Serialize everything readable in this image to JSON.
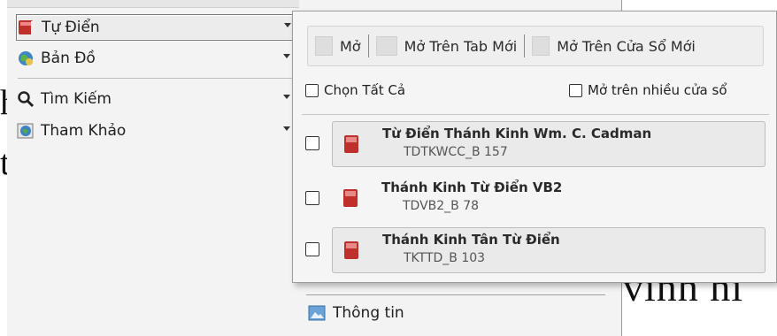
{
  "background": {
    "text_h": "h",
    "text_t": "t",
    "text_vinh": "vinh hi"
  },
  "left_menu": {
    "items": [
      {
        "label": "Tự Điển",
        "icon": "dictionary-book-icon"
      },
      {
        "label": "Bản Đồ",
        "icon": "globe-map-icon"
      },
      {
        "label": "Tìm Kiếm",
        "icon": "search-icon"
      },
      {
        "label": "Tham Khảo",
        "icon": "reference-globe-icon"
      }
    ]
  },
  "right_panel": {
    "info_label": "Thông tin"
  },
  "popup": {
    "toolbar": {
      "open_label": "Mở",
      "open_new_tab_label": "Mở Trên Tab Mới",
      "open_new_window_label": "Mở Trên Cửa Sổ Mới"
    },
    "select_all_label": "Chọn Tất Cả",
    "multi_window_label": "Mở trên nhiều cửa sổ",
    "entries": [
      {
        "title": "Từ Điển Thánh Kinh Wm. C. Cadman",
        "code": "TDTKWCC_B 157"
      },
      {
        "title": "Thánh Kinh Từ Điển VB2",
        "code": "TDVB2_B 78"
      },
      {
        "title": "Thánh Kinh Tân Từ Điển",
        "code": "TKTTD_B 103"
      }
    ]
  },
  "colors": {
    "book_red": "#c0302b",
    "panel_bg": "#f3f3f3",
    "popup_bg": "#f5f5f5"
  }
}
